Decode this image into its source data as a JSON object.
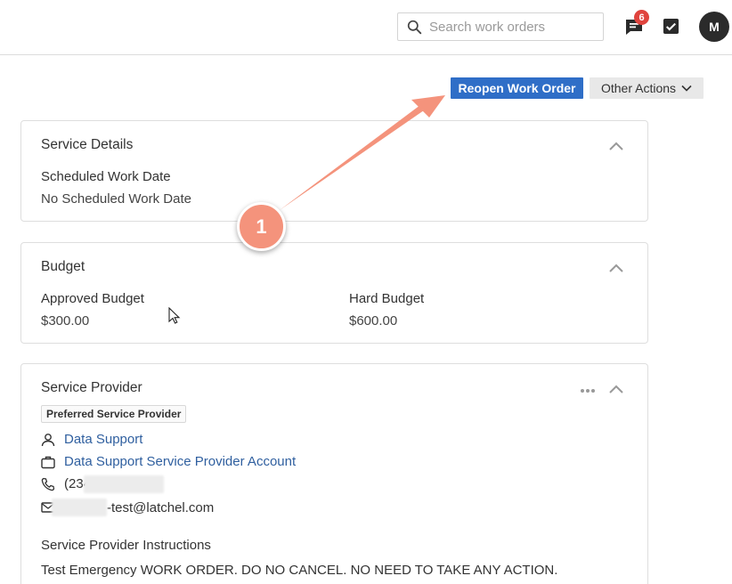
{
  "header": {
    "search_placeholder": "Search work orders",
    "notifications_count": "6",
    "avatar_initial": "M"
  },
  "actions": {
    "reopen_label": "Reopen Work Order",
    "other_actions_label": "Other Actions"
  },
  "service_details": {
    "title": "Service Details",
    "scheduled_label": "Scheduled Work Date",
    "scheduled_value": "No Scheduled Work Date"
  },
  "budget": {
    "title": "Budget",
    "approved_label": "Approved Budget",
    "approved_value": "$300.00",
    "hard_label": "Hard Budget",
    "hard_value": "$600.00"
  },
  "service_provider": {
    "title": "Service Provider",
    "tag": "Preferred Service Provider",
    "contact_name": "Data Support",
    "account_name": "Data Support Service Provider Account",
    "phone_visible": "(234) 567-8953",
    "email_visible": "-test@latchel.com",
    "instructions_label": "Service Provider Instructions",
    "instructions_text": "Test Emergency WORK ORDER. DO NO CANCEL. NO NEED TO TAKE ANY ACTION."
  },
  "annotation": {
    "step_number": "1"
  },
  "colors": {
    "primary": "#2f6ec7",
    "badge": "#e0443e",
    "annotation": "#f4937c",
    "link": "#2f5f9f"
  }
}
